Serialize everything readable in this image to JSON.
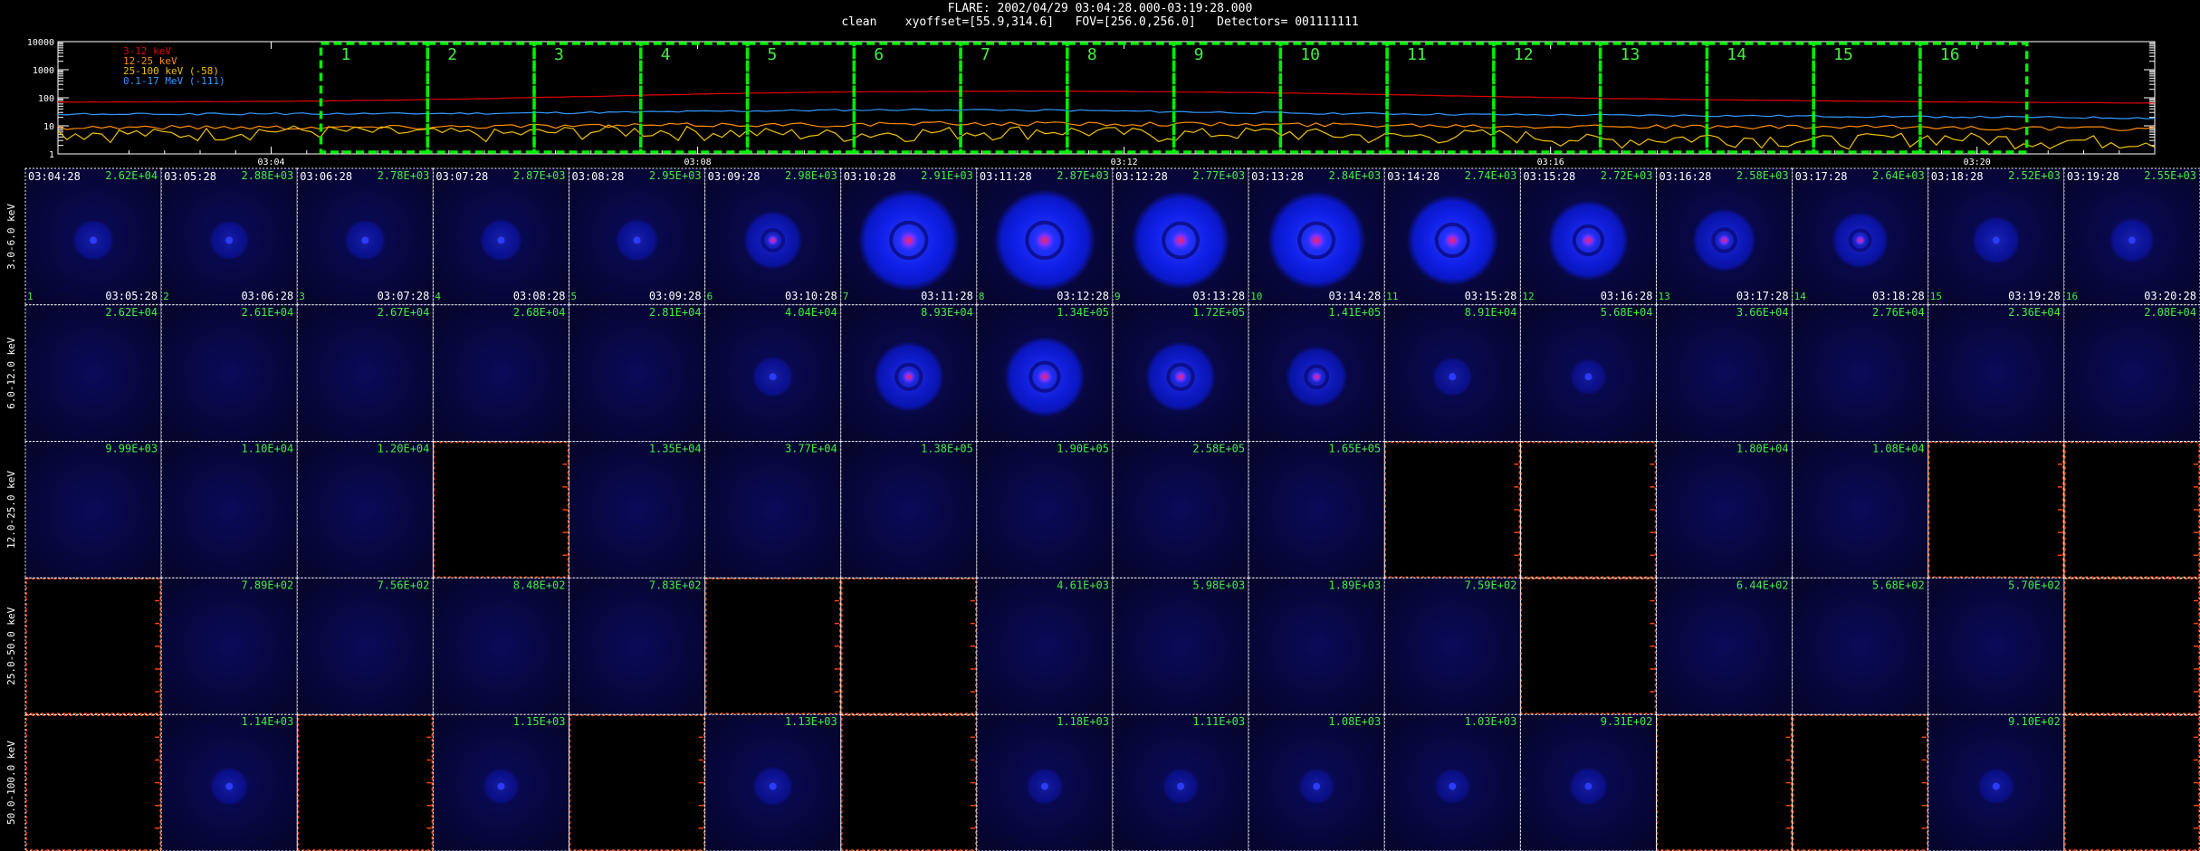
{
  "header": {
    "line1": "FLARE: 2002/04/29 03:04:28.000-03:19:28.000",
    "line2": "clean    xyoffset=[55.9,314.6]   FOV=[256.0,256.0]   Detectors= 001111111"
  },
  "chart_data": {
    "type": "line",
    "lightcurve": {
      "ylim": [
        1,
        10000
      ],
      "log_y": true,
      "y_ticks": [
        "10000",
        "1000",
        "100",
        "10",
        "1"
      ],
      "x_ticks": [
        "03:04",
        "03:08",
        "03:12",
        "03:16",
        "03:20"
      ],
      "x_range": [
        "03:02:00",
        "03:21:40"
      ],
      "legend_placement": "top-left",
      "series": [
        {
          "name": "3-12 keV",
          "color": "#e00000",
          "values": [
            70,
            72,
            75,
            82,
            95,
            115,
            140,
            160,
            170,
            172,
            165,
            150,
            130,
            110,
            95,
            85,
            78,
            72,
            68,
            65
          ]
        },
        {
          "name": "12-25 keV",
          "color": "#ff8c00",
          "values": [
            9,
            9,
            9,
            9,
            10,
            10,
            11,
            11,
            12,
            12,
            12,
            11,
            11,
            10,
            10,
            9,
            9,
            9,
            8,
            8
          ]
        },
        {
          "name": "25-100 keV (-58)",
          "color": "#f0c000",
          "values": [
            6,
            5,
            7,
            6,
            5,
            7,
            6,
            5,
            6,
            7,
            5,
            6,
            4,
            5,
            3,
            4,
            3,
            4,
            3,
            3
          ]
        },
        {
          "name": "0.1-17 MeV (-111)",
          "color": "#3399ff",
          "values": [
            26,
            26,
            27,
            27,
            28,
            30,
            33,
            36,
            38,
            36,
            32,
            29,
            27,
            25,
            24,
            23,
            22,
            21,
            20,
            19
          ]
        }
      ],
      "interval_labels": [
        "1",
        "2",
        "3",
        "4",
        "5",
        "6",
        "7",
        "8",
        "9",
        "10",
        "11",
        "12",
        "13",
        "14",
        "15",
        "16"
      ]
    },
    "image_grid": {
      "energy_bands": [
        "3.0-6.0 keV",
        "6.0-12.0 keV",
        "12.0-25.0 keV",
        "25.0-50.0 keV",
        "50.0-100.0 keV"
      ],
      "start_times": [
        "03:04:28",
        "03:05:28",
        "03:06:28",
        "03:07:28",
        "03:08:28",
        "03:09:28",
        "03:10:28",
        "03:11:28",
        "03:12:28",
        "03:13:28",
        "03:14:28",
        "03:15:28",
        "03:16:28",
        "03:17:28",
        "03:18:28",
        "03:19:28"
      ],
      "end_times": [
        "03:05:28",
        "03:06:28",
        "03:07:28",
        "03:08:28",
        "03:09:28",
        "03:10:28",
        "03:11:28",
        "03:12:28",
        "03:13:28",
        "03:14:28",
        "03:15:28",
        "03:16:28",
        "03:17:28",
        "03:18:28",
        "03:19:28",
        "03:20:28"
      ],
      "peak_values": [
        [
          "2.62E+04",
          "2.88E+03",
          "2.78E+03",
          "2.87E+03",
          "2.95E+03",
          "2.98E+03",
          "2.91E+03",
          "2.87E+03",
          "2.77E+03",
          "2.84E+03",
          "2.74E+03",
          "2.72E+03",
          "2.58E+03",
          "2.64E+03",
          "2.52E+03",
          "2.55E+03"
        ],
        [
          "2.62E+04",
          "2.61E+04",
          "2.67E+04",
          "2.68E+04",
          "2.81E+04",
          "4.04E+04",
          "8.93E+04",
          "1.34E+05",
          "1.72E+05",
          "1.41E+05",
          "8.91E+04",
          "5.68E+04",
          "3.66E+04",
          "2.76E+04",
          "2.36E+04",
          "2.08E+04"
        ],
        [
          "9.99E+03",
          "1.10E+04",
          "1.20E+04",
          "",
          "1.35E+04",
          "3.77E+04",
          "1.38E+05",
          "1.90E+05",
          "2.58E+05",
          "1.65E+05",
          "",
          "",
          "1.80E+04",
          "1.08E+04",
          "",
          ""
        ],
        [
          "",
          "7.89E+02",
          "7.56E+02",
          "8.48E+02",
          "7.83E+02",
          "",
          "",
          "4.61E+03",
          "5.98E+03",
          "1.89E+03",
          "7.59E+02",
          "",
          "6.44E+02",
          "5.68E+02",
          "5.70E+02",
          ""
        ],
        [
          "",
          "1.14E+03",
          "",
          "1.15E+03",
          "",
          "1.13E+03",
          "",
          "1.18E+03",
          "1.11E+03",
          "1.08E+03",
          "1.03E+03",
          "9.31E+02",
          "",
          "",
          "9.10E+02",
          ""
        ]
      ],
      "source_strength": [
        [
          0.12,
          0.1,
          0.12,
          0.14,
          0.15,
          0.38,
          1.0,
          1.0,
          0.95,
          0.95,
          0.85,
          0.7,
          0.45,
          0.35,
          0.22,
          0.18
        ],
        [
          0,
          0,
          0,
          0,
          0,
          0.12,
          0.55,
          0.7,
          0.55,
          0.42,
          0.1,
          0.05,
          0,
          0,
          0,
          0
        ],
        [
          0,
          0,
          0,
          0,
          0,
          0,
          0,
          0,
          0,
          0,
          0,
          0,
          0,
          0,
          0,
          0
        ],
        [
          0,
          0,
          0,
          0,
          0,
          0,
          0,
          0,
          0,
          0,
          0,
          0,
          0,
          0,
          0,
          0
        ],
        [
          0,
          0.08,
          0,
          0.05,
          0,
          0.1,
          0,
          0.06,
          0.05,
          0.05,
          0.04,
          0.08,
          0,
          0,
          0.05,
          0
        ]
      ],
      "has_image": [
        [
          1,
          1,
          1,
          1,
          1,
          1,
          1,
          1,
          1,
          1,
          1,
          1,
          1,
          1,
          1,
          1
        ],
        [
          1,
          1,
          1,
          1,
          1,
          1,
          1,
          1,
          1,
          1,
          1,
          1,
          1,
          1,
          1,
          1
        ],
        [
          1,
          1,
          1,
          0,
          1,
          1,
          1,
          1,
          1,
          1,
          0,
          0,
          1,
          1,
          0,
          0
        ],
        [
          0,
          1,
          1,
          1,
          1,
          0,
          0,
          1,
          1,
          1,
          1,
          0,
          1,
          1,
          1,
          0
        ],
        [
          0,
          1,
          0,
          1,
          0,
          1,
          0,
          1,
          1,
          1,
          1,
          1,
          0,
          0,
          1,
          0
        ]
      ]
    }
  },
  "colors": {
    "interval_box": "#00ee00",
    "label_green": "#44ee44",
    "panel_bg": "#06063a",
    "empty_panel_border": "#ff4400",
    "grid_line": "#ffffff"
  }
}
